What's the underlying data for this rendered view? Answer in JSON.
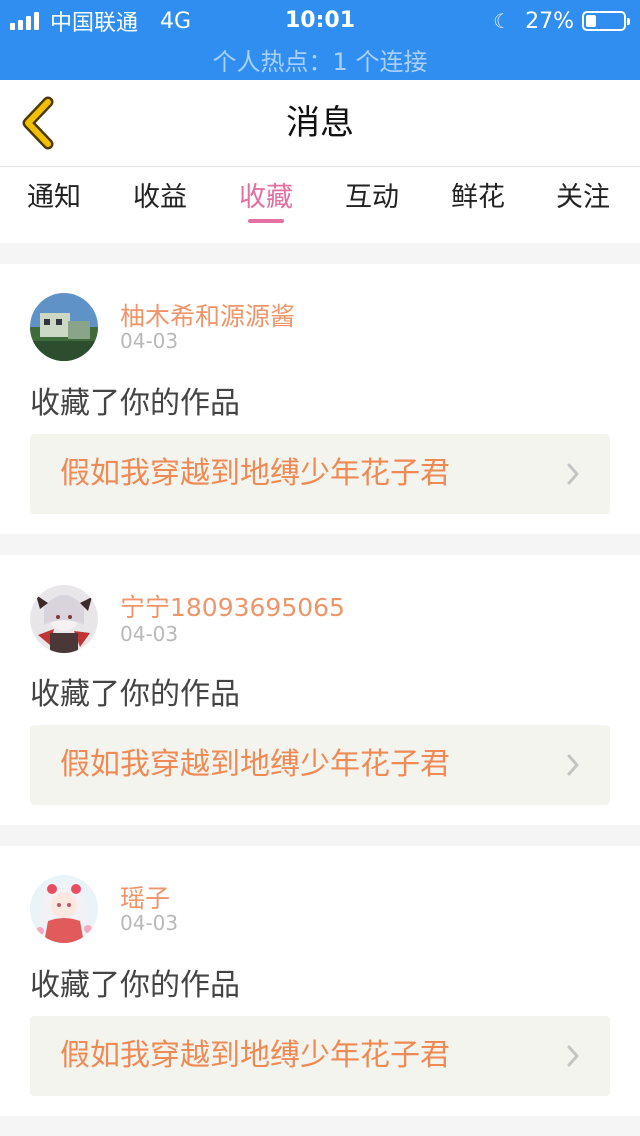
{
  "status_bar": {
    "carrier": "中国联通",
    "network": "4G",
    "time": "10:01",
    "battery": "27%",
    "battery_level": 0.27,
    "hotspot": "个人热点：1 个连接"
  },
  "nav": {
    "title": "消息",
    "back_icon": "chevron-left-icon"
  },
  "tabs": [
    {
      "label": "通知",
      "active": false
    },
    {
      "label": "收益",
      "active": false
    },
    {
      "label": "收藏",
      "active": true
    },
    {
      "label": "互动",
      "active": false
    },
    {
      "label": "鲜花",
      "active": false
    },
    {
      "label": "关注",
      "active": false
    }
  ],
  "messages": [
    {
      "user": "柚木希和源源酱",
      "date": "04-03",
      "action": "收藏了你的作品",
      "work_title": "假如我穿越到地缚少年花子君"
    },
    {
      "user": "宁宁18093695065",
      "date": "04-03",
      "action": "收藏了你的作品",
      "work_title": "假如我穿越到地缚少年花子君"
    },
    {
      "user": "瑶子",
      "date": "04-03",
      "action": "收藏了你的作品",
      "work_title": "假如我穿越到地缚少年花子君"
    }
  ],
  "colors": {
    "status_bar_bg": "#2f8ef0",
    "accent_pink": "#e46fa1",
    "username_orange": "#f0956a",
    "work_title_orange": "#ef8a55",
    "back_icon_color": "#f2c000"
  }
}
